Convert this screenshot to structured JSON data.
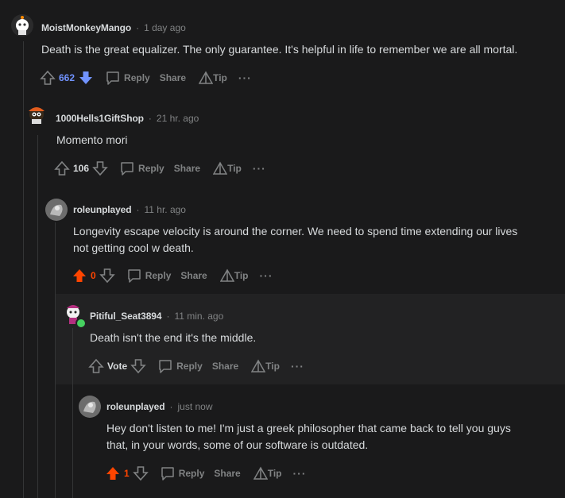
{
  "comments": [
    {
      "username": "MoistMonkeyMango",
      "time": "1 day ago",
      "text": "Death is the great equalizer. The only guarantee. It's helpful in life to remember we are all mortal.",
      "votes": "662",
      "reply": "Reply",
      "share": "Share",
      "tip": "Tip",
      "more": "···",
      "vote_color": "#7193ff"
    },
    {
      "username": "1000Hells1GiftShop",
      "time": "21 hr. ago",
      "text": "Momento mori",
      "votes": "106",
      "reply": "Reply",
      "share": "Share",
      "tip": "Tip",
      "more": "···"
    },
    {
      "username": "roleunplayed",
      "time": "11 hr. ago",
      "text_line1": "Longevity escape velocity is around the corner. We need to spend time extending our lives",
      "text_line2": "not getting cool w death.",
      "votes": "0",
      "reply": "Reply",
      "share": "Share",
      "tip": "Tip",
      "more": "···",
      "vote_color": "#ff4500"
    },
    {
      "username": "Pitiful_Seat3894",
      "time": "11 min. ago",
      "text": "Death isn't the end it's the middle.",
      "votes": "Vote",
      "reply": "Reply",
      "share": "Share",
      "tip": "Tip",
      "more": "···"
    },
    {
      "username": "roleunplayed",
      "time": "just now",
      "text_line1": "Hey don't listen to me! I'm just a greek philosopher that came back to tell you guys",
      "text_line2": "that, in your words, some of our software is outdated.",
      "votes": "1",
      "reply": "Reply",
      "share": "Share",
      "tip": "Tip",
      "more": "···",
      "vote_color": "#ff4500"
    }
  ],
  "meta_separator": "·"
}
